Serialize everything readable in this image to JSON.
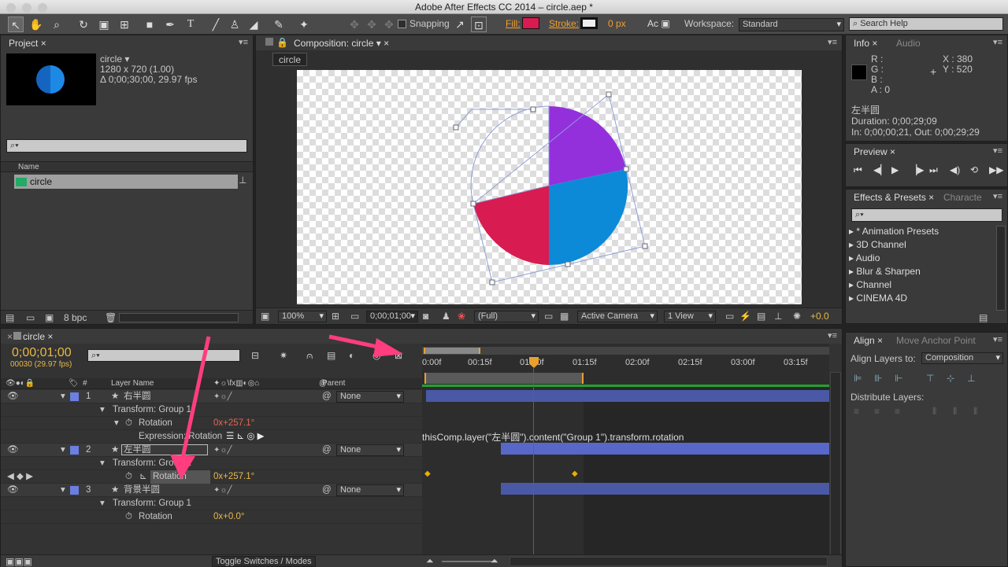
{
  "window": {
    "title": "Adobe After Effects CC 2014 – circle.aep *"
  },
  "toolbar": {
    "snapping": "Snapping",
    "fill_label": "Fill:",
    "fill_color": "#d81b50",
    "stroke_label": "Stroke:",
    "stroke_px": "0 px",
    "workspace_label": "Workspace:",
    "workspace_value": "Standard",
    "search_placeholder": "Search Help"
  },
  "project": {
    "tab": "Project",
    "comp_name": "circle ▾",
    "comp_size": "1280 x 720 (1.00)",
    "comp_duration": "Δ 0;00;30;00, 29.97 fps",
    "column_name": "Name",
    "item": "circle",
    "bpc": "8 bpc"
  },
  "composition": {
    "tab": "Composition: circle",
    "crumb": "circle",
    "zoom": "100%",
    "timecode": "0;00;01;00",
    "resolution": "(Full)",
    "camera": "Active Camera",
    "view": "1 View",
    "exposure": "+0.0"
  },
  "pie": {
    "purple": "#9330db",
    "blue": "#0c8ad8",
    "red": "#d81b50"
  },
  "info": {
    "tab": "Info",
    "tab2": "Audio",
    "r": "R :",
    "g": "G :",
    "b": "B :",
    "a": "A : 0",
    "x": "X : 380",
    "y": "Y : 520",
    "layer": "左半圆",
    "duration": "Duration: 0;00;29;09",
    "inout": "In: 0;00;00;21, Out: 0;00;29;29"
  },
  "preview": {
    "tab": "Preview"
  },
  "effects": {
    "tab": "Effects & Presets",
    "tab2": "Characte",
    "items": [
      "* Animation Presets",
      "3D Channel",
      "Audio",
      "Blur & Sharpen",
      "Channel",
      "CINEMA 4D"
    ]
  },
  "align": {
    "tab": "Align",
    "tab2": "Move Anchor Point",
    "align_to_label": "Align Layers to:",
    "align_to_value": "Composition",
    "distribute_label": "Distribute Layers:"
  },
  "timeline": {
    "tab": "circle",
    "timecode": "0;00;01;00",
    "frames": "00030 (29.97 fps)",
    "col_layer": "Layer Name",
    "col_parent": "Parent",
    "toggle": "Toggle Switches / Modes",
    "ruler": [
      "0:00f",
      "00:15f",
      "01:00f",
      "01:15f",
      "02:00f",
      "02:15f",
      "03:00f",
      "03:15f"
    ],
    "layers": [
      {
        "num": "1",
        "name": "右半圆",
        "group": "Transform: Group 1",
        "prop": "Rotation",
        "value": "0x+257.1°",
        "expr_label": "Expression: Rotation",
        "expr": "thisComp.layer(\"左半圆\").content(\"Group 1\").transform.rotation",
        "parent": "None"
      },
      {
        "num": "2",
        "name": "左半圆",
        "group": "Transform: Group 1",
        "prop": "Rotation",
        "value": "0x+257.1°",
        "parent": "None"
      },
      {
        "num": "3",
        "name": "背景半圆",
        "group": "Transform: Group 1",
        "prop": "Rotation",
        "value": "0x+0.0°",
        "parent": "None"
      }
    ]
  }
}
